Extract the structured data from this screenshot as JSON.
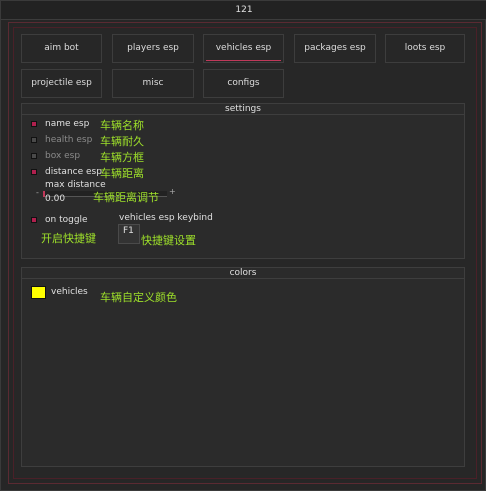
{
  "window": {
    "title": "121"
  },
  "tabs": [
    {
      "label": "aim bot",
      "active": false
    },
    {
      "label": "players esp",
      "active": false
    },
    {
      "label": "vehicles esp",
      "active": true
    },
    {
      "label": "packages esp",
      "active": false
    },
    {
      "label": "loots esp",
      "active": false
    },
    {
      "label": "projectile esp",
      "active": false
    },
    {
      "label": "misc",
      "active": false
    },
    {
      "label": "configs",
      "active": false
    }
  ],
  "settings": {
    "header": "settings",
    "checkboxes": [
      {
        "label": "name esp",
        "checked": true,
        "note": "车辆名称"
      },
      {
        "label": "health esp",
        "checked": false,
        "note": "车辆耐久"
      },
      {
        "label": "box esp",
        "checked": false,
        "note": "车辆方框"
      },
      {
        "label": "distance esp",
        "checked": true,
        "note": "车辆距离"
      }
    ],
    "slider": {
      "label": "max distance",
      "value": "0.00",
      "fraction": 0.0,
      "note": "车辆距离调节",
      "minus": "-",
      "plus": "+"
    },
    "toggle": {
      "label": "on toggle",
      "checked": true,
      "note": "开启快捷键"
    },
    "keybind": {
      "label": "vehicles esp keybind",
      "value": "F1",
      "note": "快捷键设置"
    }
  },
  "colors": {
    "header": "colors",
    "items": [
      {
        "label": "vehicles",
        "color": "#ffff00",
        "note": "车辆自定义颜色"
      }
    ]
  },
  "accent": "#c0395a",
  "note_color": "#9ee02a"
}
